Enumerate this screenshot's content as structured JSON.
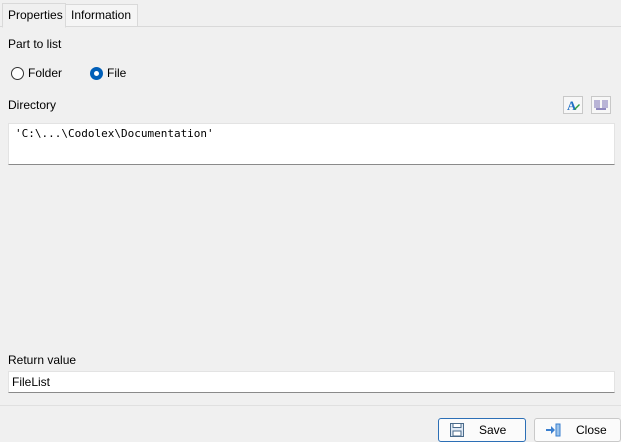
{
  "tabs": [
    {
      "label": "Properties",
      "active": true
    },
    {
      "label": "Information",
      "active": false
    }
  ],
  "part_to_list": {
    "label": "Part to list",
    "options": [
      {
        "label": "Folder",
        "checked": false
      },
      {
        "label": "File",
        "checked": true
      }
    ]
  },
  "directory": {
    "label": "Directory",
    "value": "'C:\\...\\Codolex\\Documentation'",
    "tools": [
      "text-format-icon",
      "parameter-icon"
    ]
  },
  "return_value": {
    "label": "Return value",
    "value": "FileList"
  },
  "buttons": {
    "save": "Save",
    "close": "Close"
  },
  "colors": {
    "accent": "#005fb8",
    "background": "#f0f0f0"
  }
}
